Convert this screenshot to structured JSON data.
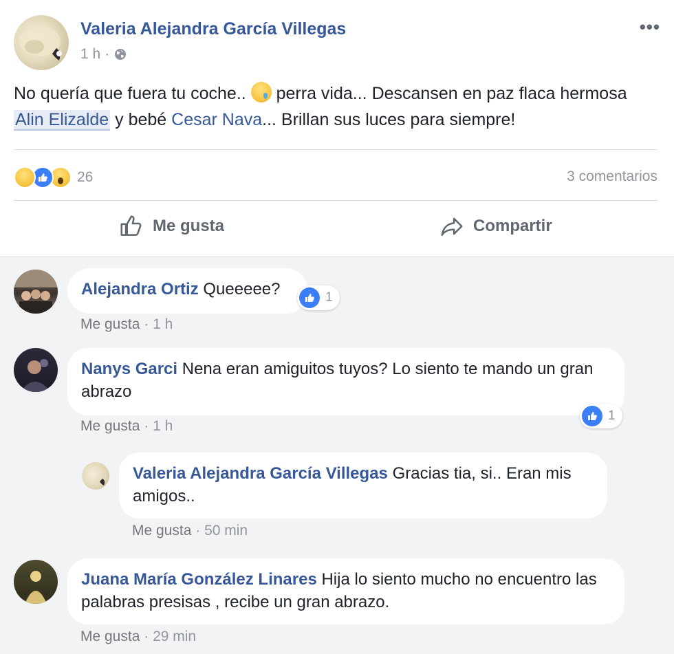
{
  "post": {
    "author": "Valeria Alejandra García Villegas",
    "time": "1 h",
    "text_before": "No quería que fuera tu coche.. ",
    "text_after_emoji": " perra vida... Descansen en paz flaca hermosa ",
    "mention_1": "Alin Elizalde",
    "text_mid": " y bebé ",
    "mention_2": "Cesar Nava",
    "text_end": "... Brillan sus luces para siempre!",
    "reaction_count": "26",
    "comments_label": "3 comentarios",
    "like_label": "Me gusta",
    "share_label": "Compartir"
  },
  "comments": [
    {
      "name": "Alejandra Ortiz",
      "text": "Queeeee?",
      "like_label": "Me gusta",
      "time": "1 h",
      "reactions": "1"
    },
    {
      "name": "Nanys Garci",
      "text": "Nena eran amiguitos tuyos? Lo siento te mando un gran abrazo",
      "like_label": "Me gusta",
      "time": "1 h",
      "reactions": "1"
    },
    {
      "name": "Valeria Alejandra García Villegas",
      "text": "Gracias tia, si.. Eran mis amigos..",
      "like_label": "Me gusta",
      "time": "50 min"
    },
    {
      "name": "Juana María González Linares",
      "text": "Hija lo siento mucho no encuentro las palabras presisas , recibe un gran abrazo.",
      "like_label": "Me gusta",
      "time": "29 min"
    }
  ],
  "colors": {
    "link": "#365899",
    "like_blue": "#3b7ef5",
    "muted": "#90949c",
    "thread_bg": "#f2f3f5"
  }
}
